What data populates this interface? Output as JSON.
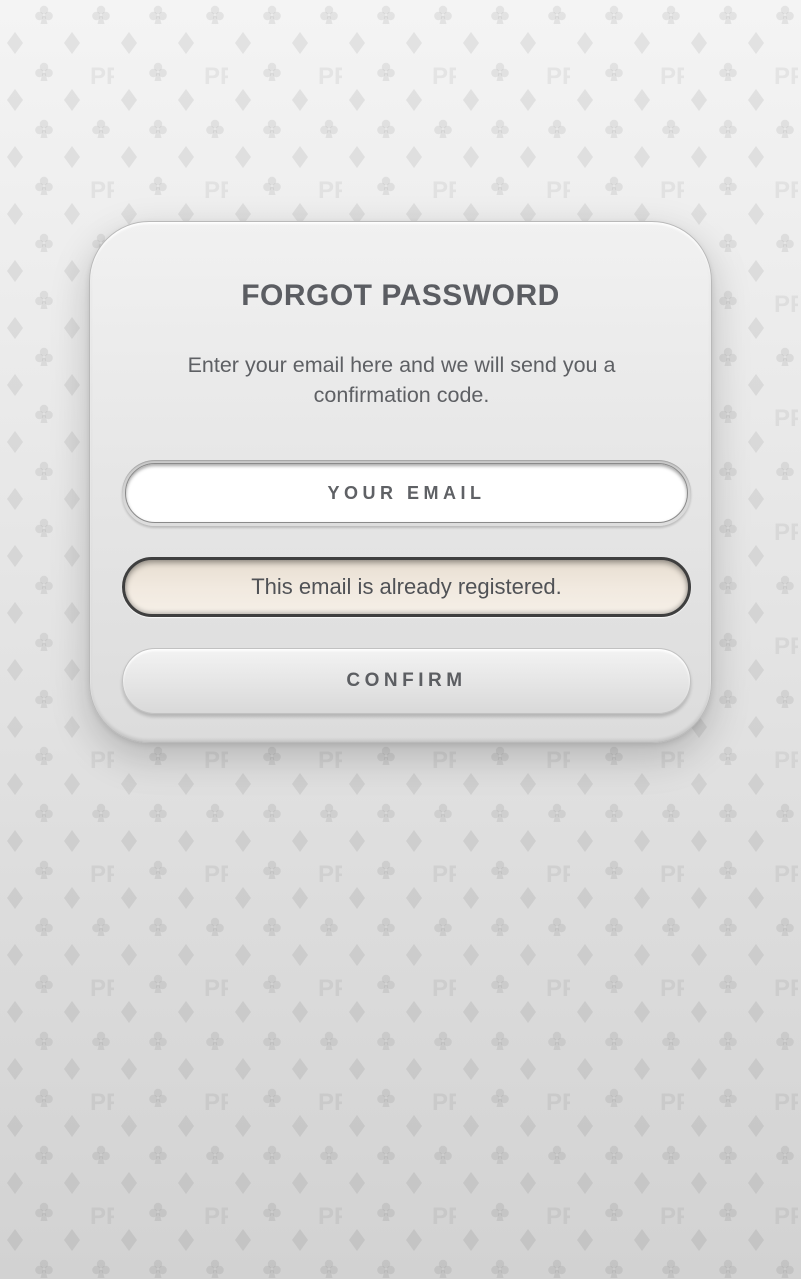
{
  "dialog": {
    "title": "FORGOT PASSWORD",
    "description": "Enter your email here and we will send you a confirmation code."
  },
  "email_field": {
    "value": "",
    "placeholder": "YOUR EMAIL"
  },
  "error": {
    "message": "This email is already registered."
  },
  "confirm_button": {
    "label": "CONFIRM"
  },
  "background": {
    "pattern_icons": [
      "club-icon",
      "diamond-icon",
      "pp-logo"
    ]
  },
  "colors": {
    "title_text": "#5b5d62",
    "error_border": "#3f3f3f",
    "error_fill": "#f1e9df",
    "card_fill": "#e7e7e7"
  }
}
